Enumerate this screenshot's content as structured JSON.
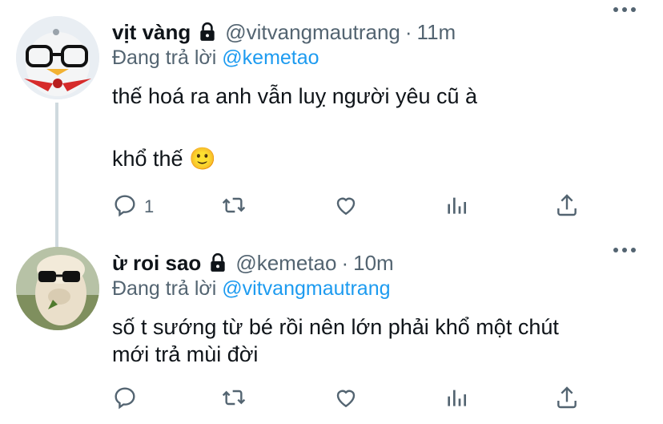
{
  "tweets": [
    {
      "display_name": "vịt vàng",
      "handle": "@vitvangmautrang",
      "separator": "·",
      "time": "11m",
      "replying_prefix": "Đang trả lời",
      "replying_to": "@kemetao",
      "lines": [
        "thế hoá ra anh vẫn luỵ người yêu cũ à",
        "",
        "khổ thế 🙂"
      ],
      "reply_count": "1",
      "icons": [
        "lock-icon",
        "reply-icon",
        "retweet-icon",
        "like-icon",
        "views-icon",
        "share-icon",
        "more-icon"
      ]
    },
    {
      "display_name": "ừ roi sao",
      "handle": "@kemetao",
      "separator": "·",
      "time": "10m",
      "replying_prefix": "Đang trả lời",
      "replying_to": "@vitvangmautrang",
      "lines": [
        "số t sướng từ bé rồi nên lớn phải khổ một chút",
        "mới trả mùi đời"
      ],
      "reply_count": "",
      "icons": [
        "lock-icon",
        "reply-icon",
        "retweet-icon",
        "like-icon",
        "views-icon",
        "share-icon",
        "more-icon"
      ]
    }
  ],
  "colors": {
    "text": "#0f1419",
    "secondary": "#536471",
    "link": "#1d9bf0",
    "thread_line": "#cfd9de"
  }
}
